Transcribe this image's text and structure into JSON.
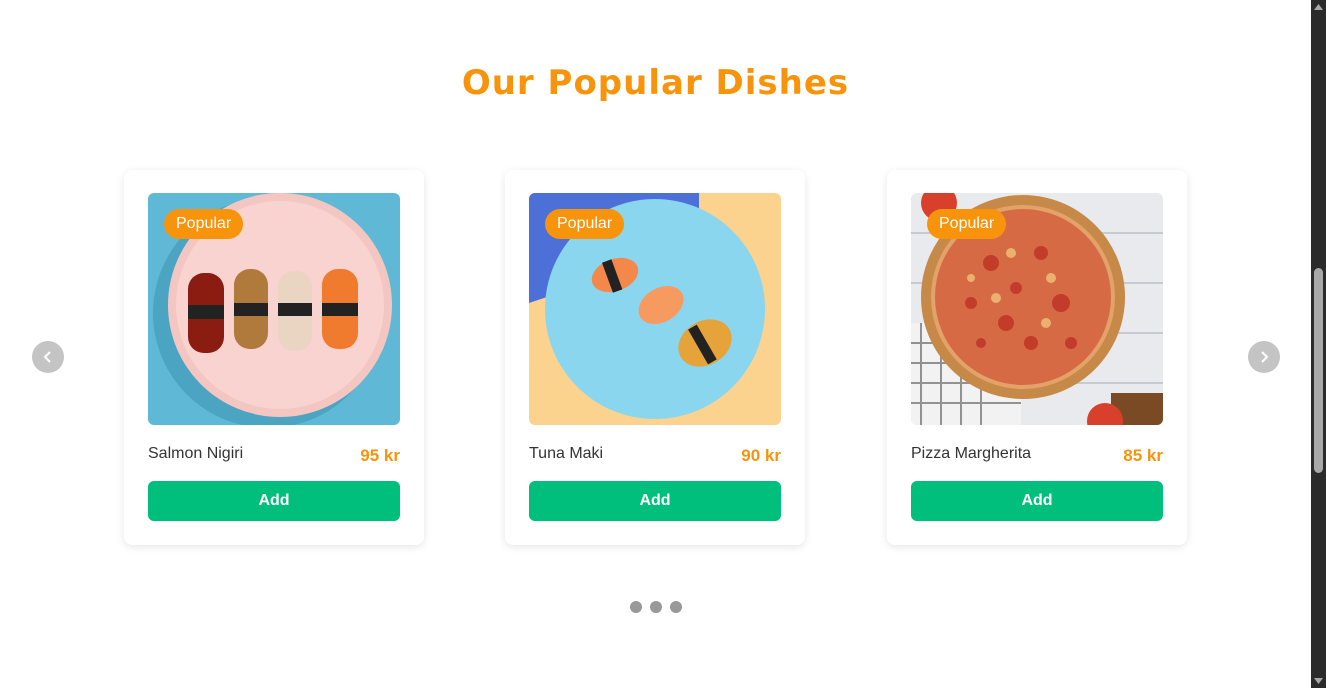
{
  "section": {
    "title": "Our Popular Dishes"
  },
  "carousel": {
    "prev_icon": "chevron-left-icon",
    "next_icon": "chevron-right-icon",
    "dot_count": 3
  },
  "dishes": [
    {
      "badge": "Popular",
      "name": "Salmon Nigiri",
      "price": "95 kr",
      "button": "Add",
      "image": "salmon-nigiri-photo"
    },
    {
      "badge": "Popular",
      "name": "Tuna Maki",
      "price": "90 kr",
      "button": "Add",
      "image": "tuna-maki-photo"
    },
    {
      "badge": "Popular",
      "name": "Pizza Margherita",
      "price": "85 kr",
      "button": "Add",
      "image": "pizza-margherita-photo"
    }
  ],
  "colors": {
    "accent": "#f7940c",
    "button": "#00bf7c",
    "arrow": "#c4c4c4",
    "dot": "#999999"
  }
}
